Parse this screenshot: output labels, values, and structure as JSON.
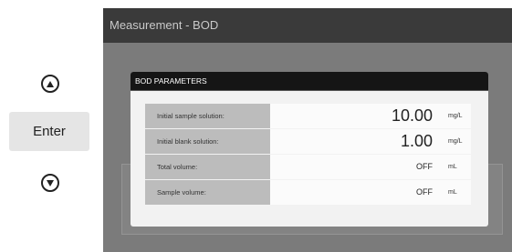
{
  "controls": {
    "up_icon": "triangle-up-icon",
    "down_icon": "triangle-down-icon",
    "enter_label": "Enter"
  },
  "screen": {
    "title": "Measurement - BOD"
  },
  "dialog": {
    "title": "BOD PARAMETERS",
    "rows": [
      {
        "label": "Initial sample solution:",
        "value": "10.00",
        "unit": "mg/L"
      },
      {
        "label": "Initial blank solution:",
        "value": "1.00",
        "unit": "mg/L"
      },
      {
        "label": "Total volume:",
        "value": "OFF",
        "unit": "mL"
      },
      {
        "label": "Sample volume:",
        "value": "OFF",
        "unit": "mL"
      }
    ]
  },
  "colors": {
    "title_bar": "#3a3a3a",
    "screen_bg": "#7b7b7b",
    "dialog_header": "#151515",
    "label_cell": "#bcbcbc"
  }
}
